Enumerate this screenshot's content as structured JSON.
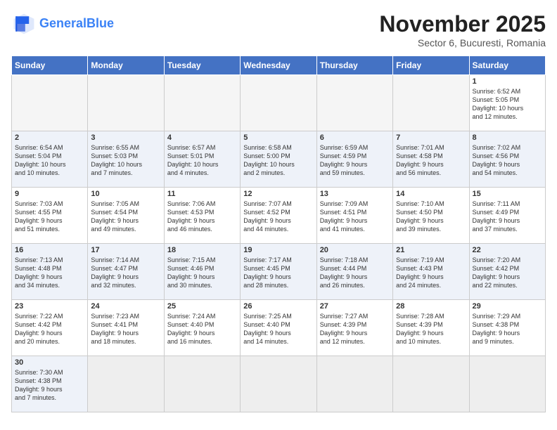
{
  "header": {
    "logo_general": "General",
    "logo_blue": "Blue",
    "month_title": "November 2025",
    "location": "Sector 6, Bucuresti, Romania"
  },
  "days_of_week": [
    "Sunday",
    "Monday",
    "Tuesday",
    "Wednesday",
    "Thursday",
    "Friday",
    "Saturday"
  ],
  "weeks": [
    [
      {
        "day": "",
        "info": ""
      },
      {
        "day": "",
        "info": ""
      },
      {
        "day": "",
        "info": ""
      },
      {
        "day": "",
        "info": ""
      },
      {
        "day": "",
        "info": ""
      },
      {
        "day": "",
        "info": ""
      },
      {
        "day": "1",
        "info": "Sunrise: 6:52 AM\nSunset: 5:05 PM\nDaylight: 10 hours\nand 12 minutes."
      }
    ],
    [
      {
        "day": "2",
        "info": "Sunrise: 6:54 AM\nSunset: 5:04 PM\nDaylight: 10 hours\nand 10 minutes."
      },
      {
        "day": "3",
        "info": "Sunrise: 6:55 AM\nSunset: 5:03 PM\nDaylight: 10 hours\nand 7 minutes."
      },
      {
        "day": "4",
        "info": "Sunrise: 6:57 AM\nSunset: 5:01 PM\nDaylight: 10 hours\nand 4 minutes."
      },
      {
        "day": "5",
        "info": "Sunrise: 6:58 AM\nSunset: 5:00 PM\nDaylight: 10 hours\nand 2 minutes."
      },
      {
        "day": "6",
        "info": "Sunrise: 6:59 AM\nSunset: 4:59 PM\nDaylight: 9 hours\nand 59 minutes."
      },
      {
        "day": "7",
        "info": "Sunrise: 7:01 AM\nSunset: 4:58 PM\nDaylight: 9 hours\nand 56 minutes."
      },
      {
        "day": "8",
        "info": "Sunrise: 7:02 AM\nSunset: 4:56 PM\nDaylight: 9 hours\nand 54 minutes."
      }
    ],
    [
      {
        "day": "9",
        "info": "Sunrise: 7:03 AM\nSunset: 4:55 PM\nDaylight: 9 hours\nand 51 minutes."
      },
      {
        "day": "10",
        "info": "Sunrise: 7:05 AM\nSunset: 4:54 PM\nDaylight: 9 hours\nand 49 minutes."
      },
      {
        "day": "11",
        "info": "Sunrise: 7:06 AM\nSunset: 4:53 PM\nDaylight: 9 hours\nand 46 minutes."
      },
      {
        "day": "12",
        "info": "Sunrise: 7:07 AM\nSunset: 4:52 PM\nDaylight: 9 hours\nand 44 minutes."
      },
      {
        "day": "13",
        "info": "Sunrise: 7:09 AM\nSunset: 4:51 PM\nDaylight: 9 hours\nand 41 minutes."
      },
      {
        "day": "14",
        "info": "Sunrise: 7:10 AM\nSunset: 4:50 PM\nDaylight: 9 hours\nand 39 minutes."
      },
      {
        "day": "15",
        "info": "Sunrise: 7:11 AM\nSunset: 4:49 PM\nDaylight: 9 hours\nand 37 minutes."
      }
    ],
    [
      {
        "day": "16",
        "info": "Sunrise: 7:13 AM\nSunset: 4:48 PM\nDaylight: 9 hours\nand 34 minutes."
      },
      {
        "day": "17",
        "info": "Sunrise: 7:14 AM\nSunset: 4:47 PM\nDaylight: 9 hours\nand 32 minutes."
      },
      {
        "day": "18",
        "info": "Sunrise: 7:15 AM\nSunset: 4:46 PM\nDaylight: 9 hours\nand 30 minutes."
      },
      {
        "day": "19",
        "info": "Sunrise: 7:17 AM\nSunset: 4:45 PM\nDaylight: 9 hours\nand 28 minutes."
      },
      {
        "day": "20",
        "info": "Sunrise: 7:18 AM\nSunset: 4:44 PM\nDaylight: 9 hours\nand 26 minutes."
      },
      {
        "day": "21",
        "info": "Sunrise: 7:19 AM\nSunset: 4:43 PM\nDaylight: 9 hours\nand 24 minutes."
      },
      {
        "day": "22",
        "info": "Sunrise: 7:20 AM\nSunset: 4:42 PM\nDaylight: 9 hours\nand 22 minutes."
      }
    ],
    [
      {
        "day": "23",
        "info": "Sunrise: 7:22 AM\nSunset: 4:42 PM\nDaylight: 9 hours\nand 20 minutes."
      },
      {
        "day": "24",
        "info": "Sunrise: 7:23 AM\nSunset: 4:41 PM\nDaylight: 9 hours\nand 18 minutes."
      },
      {
        "day": "25",
        "info": "Sunrise: 7:24 AM\nSunset: 4:40 PM\nDaylight: 9 hours\nand 16 minutes."
      },
      {
        "day": "26",
        "info": "Sunrise: 7:25 AM\nSunset: 4:40 PM\nDaylight: 9 hours\nand 14 minutes."
      },
      {
        "day": "27",
        "info": "Sunrise: 7:27 AM\nSunset: 4:39 PM\nDaylight: 9 hours\nand 12 minutes."
      },
      {
        "day": "28",
        "info": "Sunrise: 7:28 AM\nSunset: 4:39 PM\nDaylight: 9 hours\nand 10 minutes."
      },
      {
        "day": "29",
        "info": "Sunrise: 7:29 AM\nSunset: 4:38 PM\nDaylight: 9 hours\nand 9 minutes."
      }
    ],
    [
      {
        "day": "30",
        "info": "Sunrise: 7:30 AM\nSunset: 4:38 PM\nDaylight: 9 hours\nand 7 minutes."
      },
      {
        "day": "",
        "info": ""
      },
      {
        "day": "",
        "info": ""
      },
      {
        "day": "",
        "info": ""
      },
      {
        "day": "",
        "info": ""
      },
      {
        "day": "",
        "info": ""
      },
      {
        "day": "",
        "info": ""
      }
    ]
  ],
  "row_classes": [
    "row-odd",
    "row-even",
    "row-odd",
    "row-even",
    "row-odd",
    "row-even"
  ]
}
